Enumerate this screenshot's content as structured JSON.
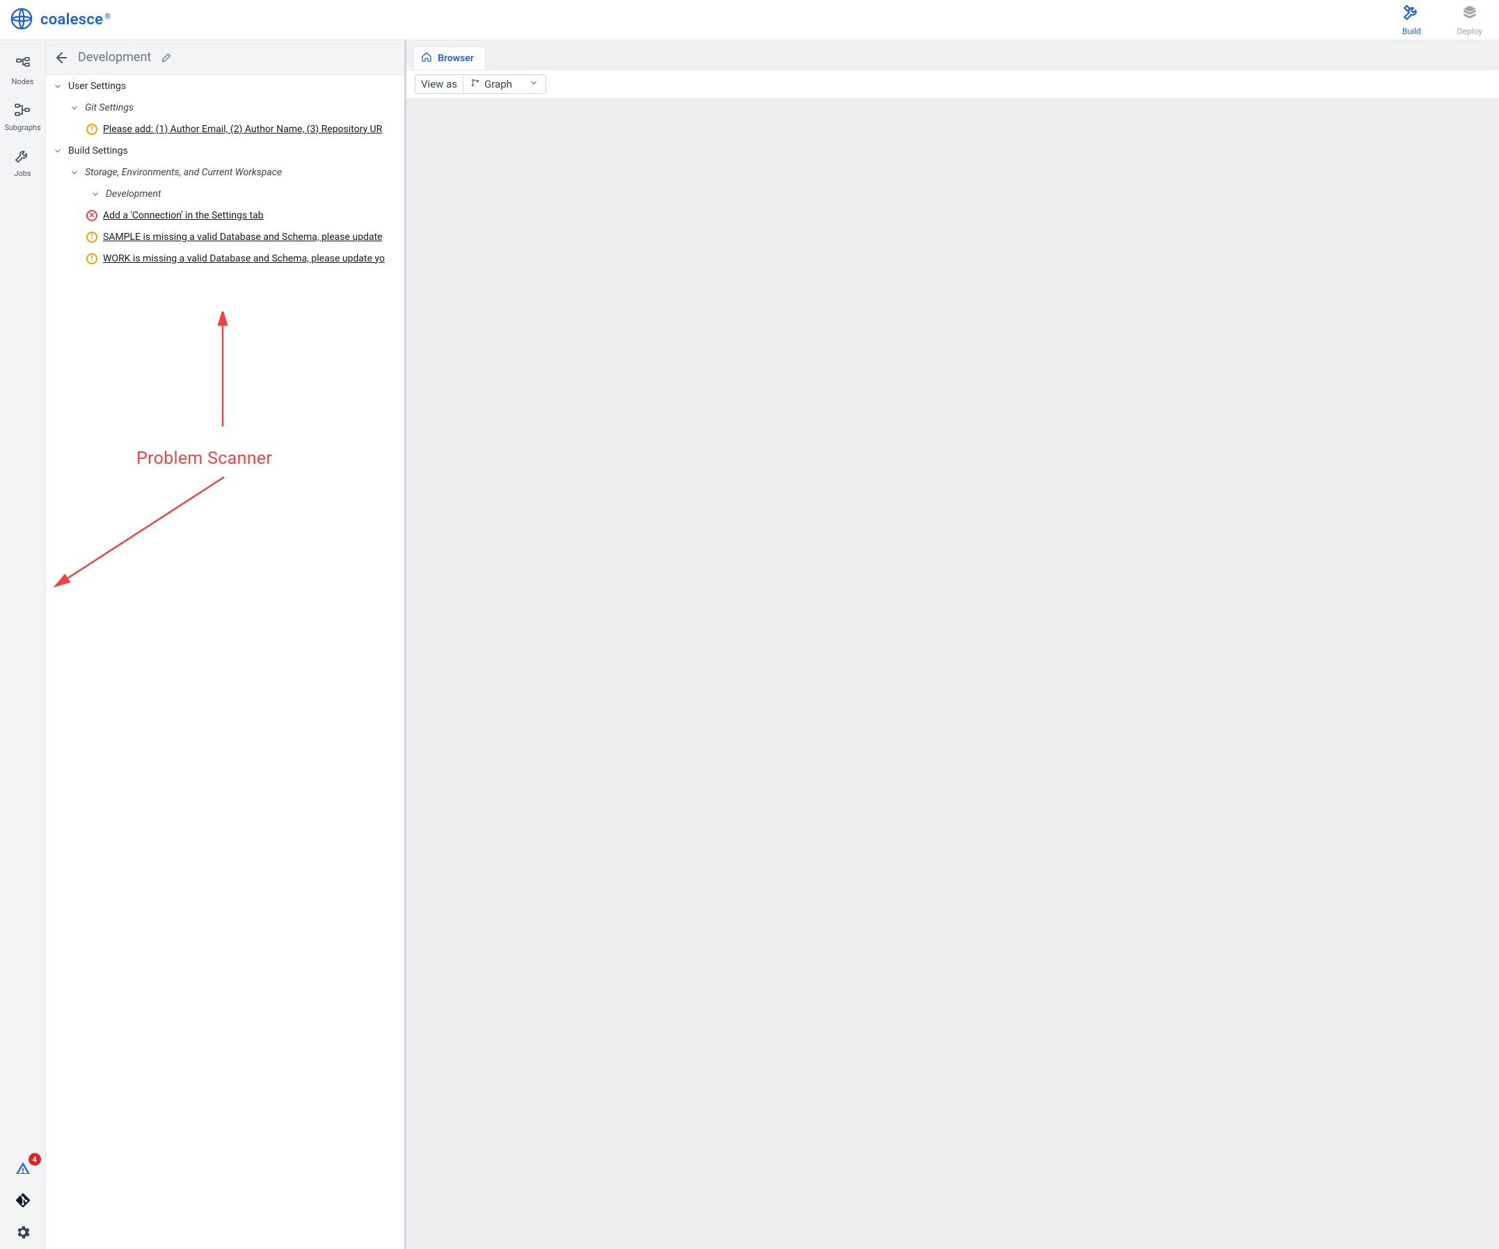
{
  "brand": {
    "name": "coalesce"
  },
  "topbar": {
    "build": "Build",
    "deploy": "Deploy"
  },
  "rail": {
    "nodes": "Nodes",
    "subgraphs": "Subgraphs",
    "jobs": "Jobs",
    "problem_count": "4"
  },
  "explorer": {
    "title": "Development",
    "groups": {
      "user_settings": "User Settings",
      "git_settings": "Git Settings",
      "git_issue": "Please add: (1) Author Email, (2) Author Name, (3) Repository UR",
      "build_settings": "Build Settings",
      "storage_env": "Storage, Environments, and Current Workspace",
      "development": "Development",
      "conn_issue": "Add a 'Connection' in the Settings tab",
      "sample_issue": "SAMPLE is missing a valid Database and Schema, please update",
      "work_issue": "WORK is missing a valid Database and Schema, please update yo"
    }
  },
  "annotation": {
    "label": "Problem Scanner"
  },
  "workspace": {
    "tab_label": "Browser",
    "viewas_label": "View as",
    "viewas_value": "Graph"
  }
}
